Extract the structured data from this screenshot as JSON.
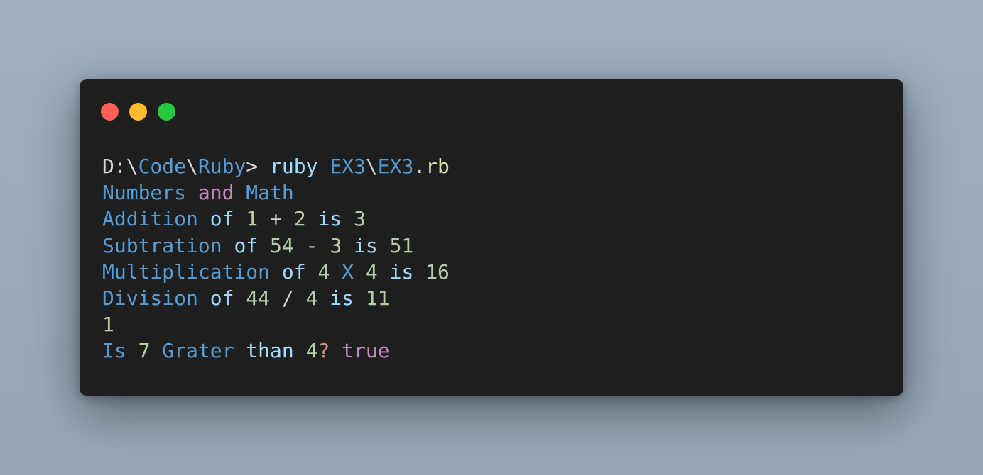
{
  "window": {
    "controls": {
      "close_color": "#ff5f56",
      "minimize_color": "#ffbd2e",
      "maximize_color": "#27c93f"
    }
  },
  "terminal": {
    "lines": [
      [
        {
          "text": "D:",
          "cls": "c-light"
        },
        {
          "text": "\\",
          "cls": "c-light"
        },
        {
          "text": "Code",
          "cls": "c-blue"
        },
        {
          "text": "\\",
          "cls": "c-light"
        },
        {
          "text": "Ruby",
          "cls": "c-blue"
        },
        {
          "text": "> ",
          "cls": "c-light"
        },
        {
          "text": "ruby ",
          "cls": "c-var"
        },
        {
          "text": "EX3",
          "cls": "c-blue"
        },
        {
          "text": "\\",
          "cls": "c-light"
        },
        {
          "text": "EX3",
          "cls": "c-blue"
        },
        {
          "text": ".rb",
          "cls": "c-yellow"
        }
      ],
      [
        {
          "text": "Numbers ",
          "cls": "c-blue"
        },
        {
          "text": "and",
          "cls": "c-pink"
        },
        {
          "text": " Math",
          "cls": "c-blue"
        }
      ],
      [
        {
          "text": "Addition ",
          "cls": "c-blue"
        },
        {
          "text": "of ",
          "cls": "c-var"
        },
        {
          "text": "1",
          "cls": "c-num"
        },
        {
          "text": " + ",
          "cls": "c-light"
        },
        {
          "text": "2",
          "cls": "c-num"
        },
        {
          "text": " is ",
          "cls": "c-var"
        },
        {
          "text": "3",
          "cls": "c-num"
        }
      ],
      [
        {
          "text": "Subtration ",
          "cls": "c-blue"
        },
        {
          "text": "of ",
          "cls": "c-var"
        },
        {
          "text": "54",
          "cls": "c-num"
        },
        {
          "text": " - ",
          "cls": "c-light"
        },
        {
          "text": "3",
          "cls": "c-num"
        },
        {
          "text": " is ",
          "cls": "c-var"
        },
        {
          "text": "51",
          "cls": "c-num"
        }
      ],
      [
        {
          "text": "Multiplication ",
          "cls": "c-blue"
        },
        {
          "text": "of ",
          "cls": "c-var"
        },
        {
          "text": "4",
          "cls": "c-num"
        },
        {
          "text": " X ",
          "cls": "c-blue"
        },
        {
          "text": "4",
          "cls": "c-num"
        },
        {
          "text": " is ",
          "cls": "c-var"
        },
        {
          "text": "16",
          "cls": "c-num"
        }
      ],
      [
        {
          "text": "Division ",
          "cls": "c-blue"
        },
        {
          "text": "of ",
          "cls": "c-var"
        },
        {
          "text": "44",
          "cls": "c-num"
        },
        {
          "text": " / ",
          "cls": "c-light"
        },
        {
          "text": "4",
          "cls": "c-num"
        },
        {
          "text": " is ",
          "cls": "c-var"
        },
        {
          "text": "11",
          "cls": "c-num"
        }
      ],
      [
        {
          "text": "1",
          "cls": "c-num"
        }
      ],
      [
        {
          "text": "Is ",
          "cls": "c-blue"
        },
        {
          "text": "7",
          "cls": "c-num"
        },
        {
          "text": " Grater ",
          "cls": "c-blue"
        },
        {
          "text": "than ",
          "cls": "c-var"
        },
        {
          "text": "4",
          "cls": "c-num"
        },
        {
          "text": "?",
          "cls": "c-orange"
        },
        {
          "text": " ",
          "cls": "c-light"
        },
        {
          "text": "true",
          "cls": "c-pink"
        }
      ]
    ]
  }
}
